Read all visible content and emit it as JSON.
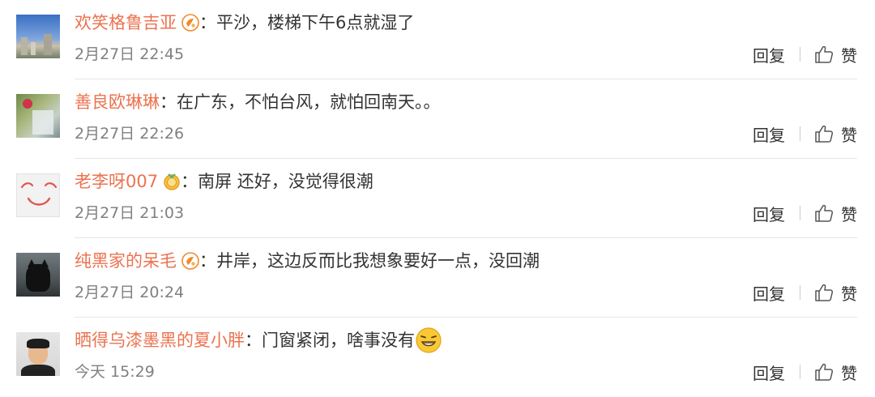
{
  "comments": [
    {
      "username": "欢笑格鲁吉亚",
      "badge": "vip-badge-icon",
      "colon": "：",
      "text": "平沙，楼梯下午6点就湿了",
      "timestamp": "2月27日 22:45",
      "reply_label": "回复",
      "like_label": "赞"
    },
    {
      "username": "善良欧琳琳",
      "colon": "：",
      "text": "在广东，不怕台风，就怕回南天。。",
      "timestamp": "2月27日 22:26",
      "reply_label": "回复",
      "like_label": "赞"
    },
    {
      "username": "老李呀007",
      "badge": "medal-badge-icon",
      "colon": "：",
      "text": "南屏 还好，没觉得很潮",
      "timestamp": "2月27日 21:03",
      "reply_label": "回复",
      "like_label": "赞"
    },
    {
      "username": "纯黑家的呆毛",
      "badge": "vip-badge-icon",
      "colon": "：",
      "text": "井岸，这边反而比我想象要好一点，没回潮",
      "timestamp": "2月27日 20:24",
      "reply_label": "回复",
      "like_label": "赞"
    },
    {
      "username": "晒得乌漆墨黑的夏小胖",
      "colon": "：",
      "text": "门窗紧闭，啥事没有",
      "emoji": "grin-emoji-icon",
      "timestamp": "今天 15:29",
      "reply_label": "回复",
      "like_label": "赞"
    }
  ],
  "colors": {
    "username": "#eb7350",
    "text": "#333333",
    "timestamp": "#808080",
    "divider": "#e6e6e6",
    "badge": "#f08a2c"
  }
}
